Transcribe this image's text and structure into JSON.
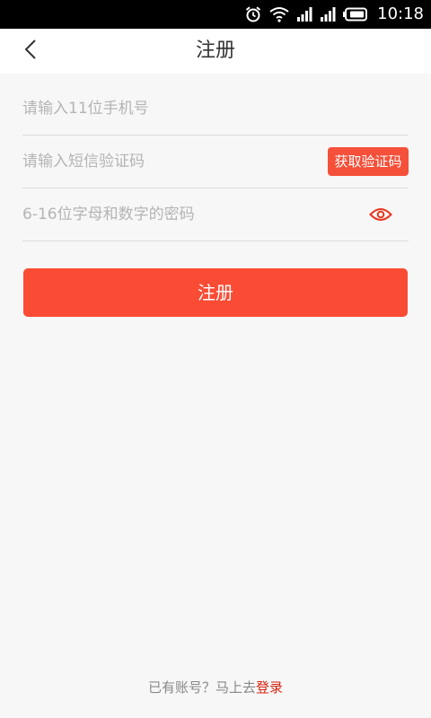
{
  "status_bar": {
    "time": "10:18",
    "icons": [
      "alarm-icon",
      "wifi-icon",
      "signal-icon",
      "signal-icon",
      "battery-icon"
    ]
  },
  "header": {
    "title": "注册",
    "back_icon": "chevron-left-icon"
  },
  "form": {
    "phone": {
      "placeholder": "请输入11位手机号",
      "value": ""
    },
    "sms_code": {
      "placeholder": "请输入短信验证码",
      "value": ""
    },
    "password": {
      "placeholder": "6-16位字母和数字的密码",
      "value": ""
    },
    "get_code_label": "获取验证码",
    "eye_icon": "eye-icon"
  },
  "register_label": "注册",
  "footer": {
    "prompt": "已有账号？马上去",
    "login_label": "登录"
  },
  "colors": {
    "accent": "#fa4b34",
    "link": "#d8250f",
    "background": "#f7f7f7"
  }
}
